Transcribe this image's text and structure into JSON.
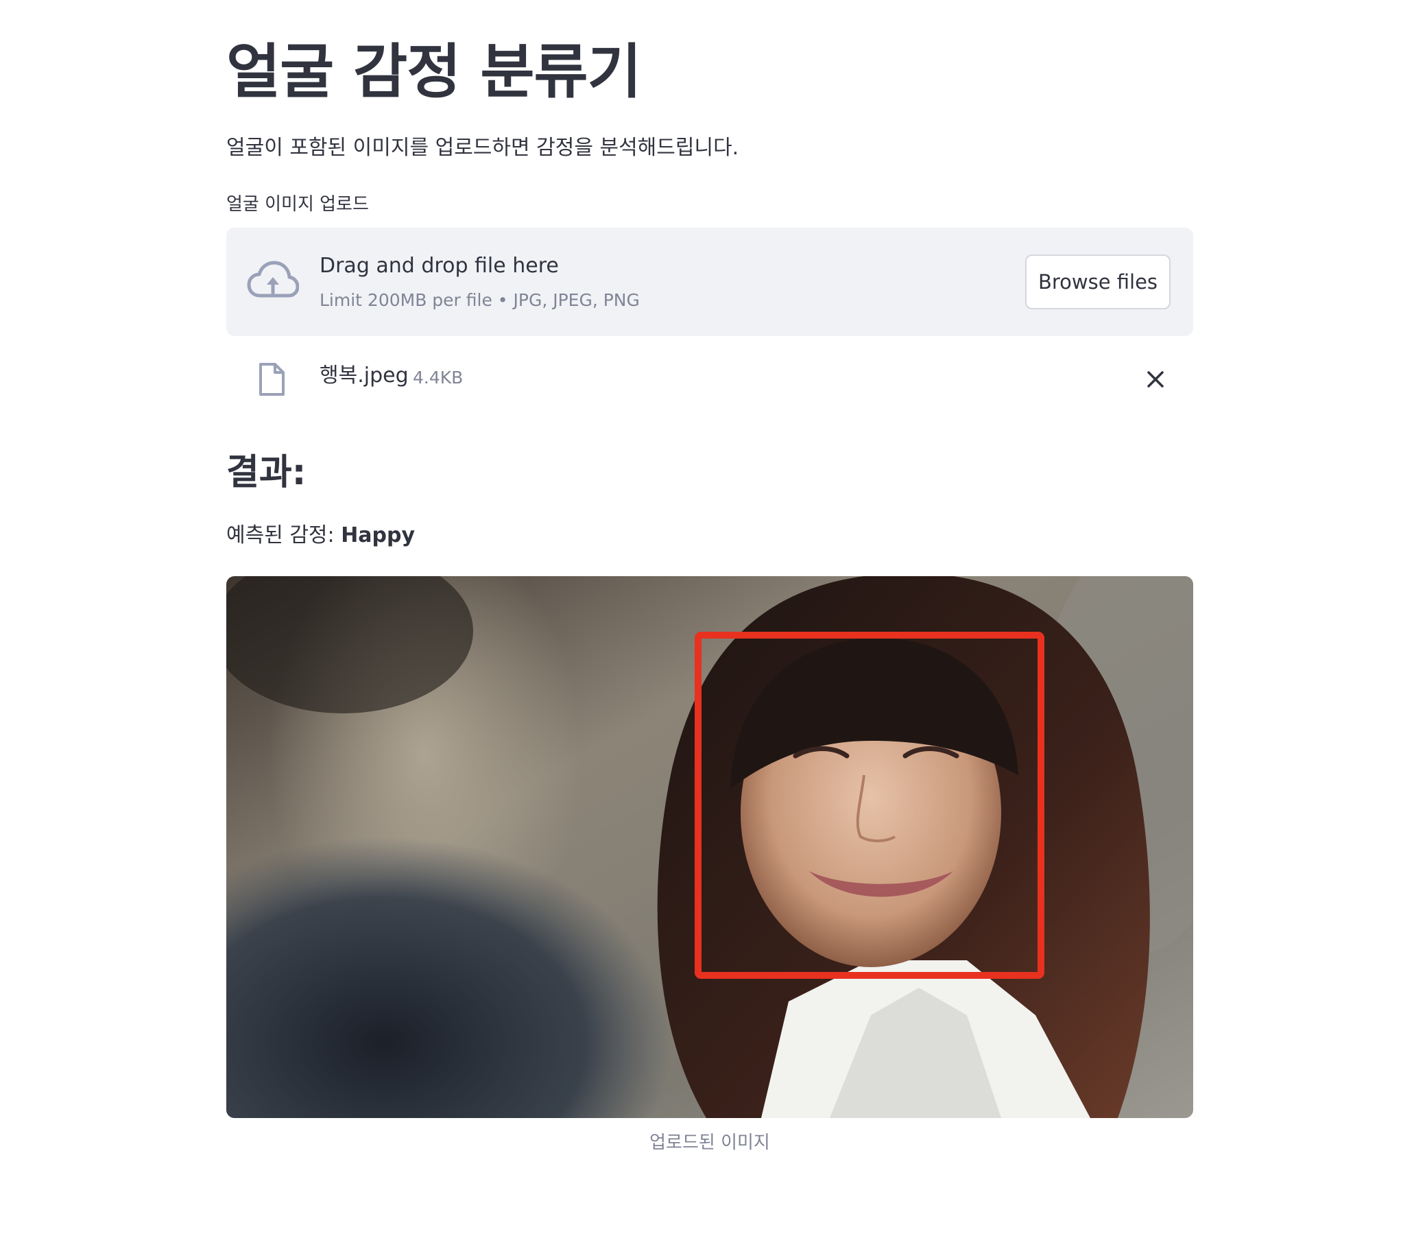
{
  "page": {
    "title": "얼굴 감정 분류기",
    "intro": "얼굴이 포함된 이미지를 업로드하면 감정을 분석해드립니다."
  },
  "uploader": {
    "label": "얼굴 이미지 업로드",
    "drop_text": "Drag and drop file here",
    "limit_text": "Limit 200MB per file • JPG, JPEG, PNG",
    "browse_label": "Browse files",
    "icon": "cloud-upload-icon"
  },
  "uploaded_file": {
    "name": "행복.jpeg",
    "size": "4.4KB",
    "icon": "file-icon",
    "remove_icon": "close-icon"
  },
  "result": {
    "heading": "결과:",
    "prediction_label": "예측된 감정: ",
    "prediction_value": "Happy",
    "caption": "업로드된 이미지"
  },
  "colors": {
    "text": "#31333f",
    "muted": "#808495",
    "dropzone_bg": "#f0f2f6",
    "face_box": "#e8311f"
  }
}
